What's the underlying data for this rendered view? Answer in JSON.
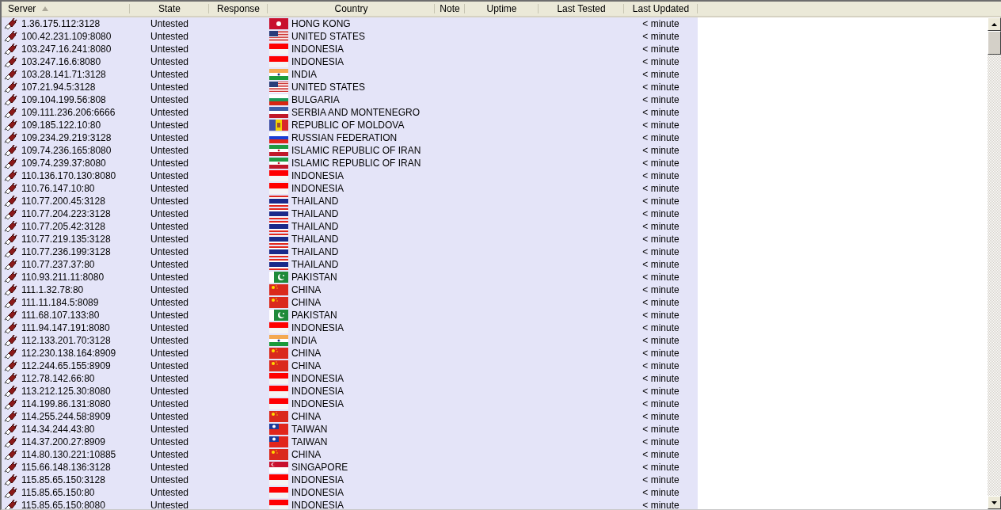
{
  "table": {
    "columns": [
      {
        "label": "Server",
        "sorted": true
      },
      {
        "label": "State",
        "sorted": false
      },
      {
        "label": "Response",
        "sorted": false
      },
      {
        "label": "Country",
        "sorted": false
      },
      {
        "label": "Note",
        "sorted": false
      },
      {
        "label": "Uptime",
        "sorted": false
      },
      {
        "label": "Last Tested",
        "sorted": false
      },
      {
        "label": "Last Updated",
        "sorted": false
      }
    ],
    "rows": [
      {
        "server": "1.36.175.112:3128",
        "state": "Untested",
        "kind": "hk",
        "country": "HONG KONG",
        "last_updated": "< minute"
      },
      {
        "server": "100.42.231.109:8080",
        "state": "Untested",
        "kind": "us",
        "country": "UNITED STATES",
        "last_updated": "< minute"
      },
      {
        "server": "103.247.16.241:8080",
        "state": "Untested",
        "kind": "id",
        "country": "INDONESIA",
        "last_updated": "< minute"
      },
      {
        "server": "103.247.16.6:8080",
        "state": "Untested",
        "kind": "id",
        "country": "INDONESIA",
        "last_updated": "< minute"
      },
      {
        "server": "103.28.141.71:3128",
        "state": "Untested",
        "kind": "in",
        "country": "INDIA",
        "last_updated": "< minute"
      },
      {
        "server": "107.21.94.5:3128",
        "state": "Untested",
        "kind": "us",
        "country": "UNITED STATES",
        "last_updated": "< minute"
      },
      {
        "server": "109.104.199.56:808",
        "state": "Untested",
        "kind": "bg",
        "country": "BULGARIA",
        "last_updated": "< minute"
      },
      {
        "server": "109.111.236.206:6666",
        "state": "Untested",
        "kind": "cs",
        "country": "SERBIA AND MONTENEGRO",
        "last_updated": "< minute"
      },
      {
        "server": "109.185.122.10:80",
        "state": "Untested",
        "kind": "md",
        "country": "REPUBLIC OF MOLDOVA",
        "last_updated": "< minute"
      },
      {
        "server": "109.234.29.219:3128",
        "state": "Untested",
        "kind": "ru",
        "country": "RUSSIAN FEDERATION",
        "last_updated": "< minute"
      },
      {
        "server": "109.74.236.165:8080",
        "state": "Untested",
        "kind": "ir",
        "country": "ISLAMIC REPUBLIC OF IRAN",
        "last_updated": "< minute"
      },
      {
        "server": "109.74.239.37:8080",
        "state": "Untested",
        "kind": "ir",
        "country": "ISLAMIC REPUBLIC OF IRAN",
        "last_updated": "< minute"
      },
      {
        "server": "110.136.170.130:8080",
        "state": "Untested",
        "kind": "id",
        "country": "INDONESIA",
        "last_updated": "< minute"
      },
      {
        "server": "110.76.147.10:80",
        "state": "Untested",
        "kind": "id",
        "country": "INDONESIA",
        "last_updated": "< minute"
      },
      {
        "server": "110.77.200.45:3128",
        "state": "Untested",
        "kind": "th",
        "country": "THAILAND",
        "last_updated": "< minute"
      },
      {
        "server": "110.77.204.223:3128",
        "state": "Untested",
        "kind": "th",
        "country": "THAILAND",
        "last_updated": "< minute"
      },
      {
        "server": "110.77.205.42:3128",
        "state": "Untested",
        "kind": "th",
        "country": "THAILAND",
        "last_updated": "< minute"
      },
      {
        "server": "110.77.219.135:3128",
        "state": "Untested",
        "kind": "th",
        "country": "THAILAND",
        "last_updated": "< minute"
      },
      {
        "server": "110.77.236.199:3128",
        "state": "Untested",
        "kind": "th",
        "country": "THAILAND",
        "last_updated": "< minute"
      },
      {
        "server": "110.77.237.37:80",
        "state": "Untested",
        "kind": "th",
        "country": "THAILAND",
        "last_updated": "< minute"
      },
      {
        "server": "110.93.211.11:8080",
        "state": "Untested",
        "kind": "pk",
        "country": "PAKISTAN",
        "last_updated": "< minute"
      },
      {
        "server": "111.1.32.78:80",
        "state": "Untested",
        "kind": "cn",
        "country": "CHINA",
        "last_updated": "< minute"
      },
      {
        "server": "111.11.184.5:8089",
        "state": "Untested",
        "kind": "cn",
        "country": "CHINA",
        "last_updated": "< minute"
      },
      {
        "server": "111.68.107.133:80",
        "state": "Untested",
        "kind": "pk",
        "country": "PAKISTAN",
        "last_updated": "< minute"
      },
      {
        "server": "111.94.147.191:8080",
        "state": "Untested",
        "kind": "id",
        "country": "INDONESIA",
        "last_updated": "< minute"
      },
      {
        "server": "112.133.201.70:3128",
        "state": "Untested",
        "kind": "in",
        "country": "INDIA",
        "last_updated": "< minute"
      },
      {
        "server": "112.230.138.164:8909",
        "state": "Untested",
        "kind": "cn",
        "country": "CHINA",
        "last_updated": "< minute"
      },
      {
        "server": "112.244.65.155:8909",
        "state": "Untested",
        "kind": "cn",
        "country": "CHINA",
        "last_updated": "< minute"
      },
      {
        "server": "112.78.142.66:80",
        "state": "Untested",
        "kind": "id",
        "country": "INDONESIA",
        "last_updated": "< minute"
      },
      {
        "server": "113.212.125.30:8080",
        "state": "Untested",
        "kind": "id",
        "country": "INDONESIA",
        "last_updated": "< minute"
      },
      {
        "server": "114.199.86.131:8080",
        "state": "Untested",
        "kind": "id",
        "country": "INDONESIA",
        "last_updated": "< minute"
      },
      {
        "server": "114.255.244.58:8909",
        "state": "Untested",
        "kind": "cn",
        "country": "CHINA",
        "last_updated": "< minute"
      },
      {
        "server": "114.34.244.43:80",
        "state": "Untested",
        "kind": "tw",
        "country": "TAIWAN",
        "last_updated": "< minute"
      },
      {
        "server": "114.37.200.27:8909",
        "state": "Untested",
        "kind": "tw",
        "country": "TAIWAN",
        "last_updated": "< minute"
      },
      {
        "server": "114.80.130.221:10885",
        "state": "Untested",
        "kind": "cn",
        "country": "CHINA",
        "last_updated": "< minute"
      },
      {
        "server": "115.66.148.136:3128",
        "state": "Untested",
        "kind": "sg",
        "country": "SINGAPORE",
        "last_updated": "< minute"
      },
      {
        "server": "115.85.65.150:3128",
        "state": "Untested",
        "kind": "id",
        "country": "INDONESIA",
        "last_updated": "< minute"
      },
      {
        "server": "115.85.65.150:80",
        "state": "Untested",
        "kind": "id",
        "country": "INDONESIA",
        "last_updated": "< minute"
      },
      {
        "server": "115.85.65.150:8080",
        "state": "Untested",
        "kind": "id",
        "country": "INDONESIA",
        "last_updated": "< minute"
      }
    ]
  }
}
